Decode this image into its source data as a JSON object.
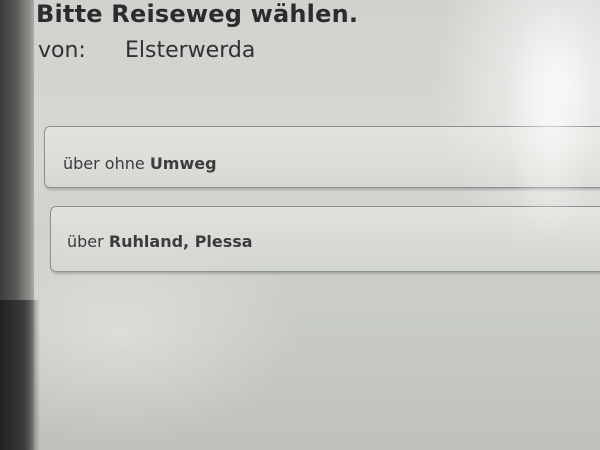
{
  "header": {
    "title": "Bitte Reiseweg wählen.",
    "from_label": "von:",
    "from_value": "Elsterwerda"
  },
  "options": [
    {
      "prefix": "über ohne",
      "emphasis": "Umweg"
    },
    {
      "prefix": "über",
      "emphasis": "Ruhland, Plessa"
    }
  ]
}
